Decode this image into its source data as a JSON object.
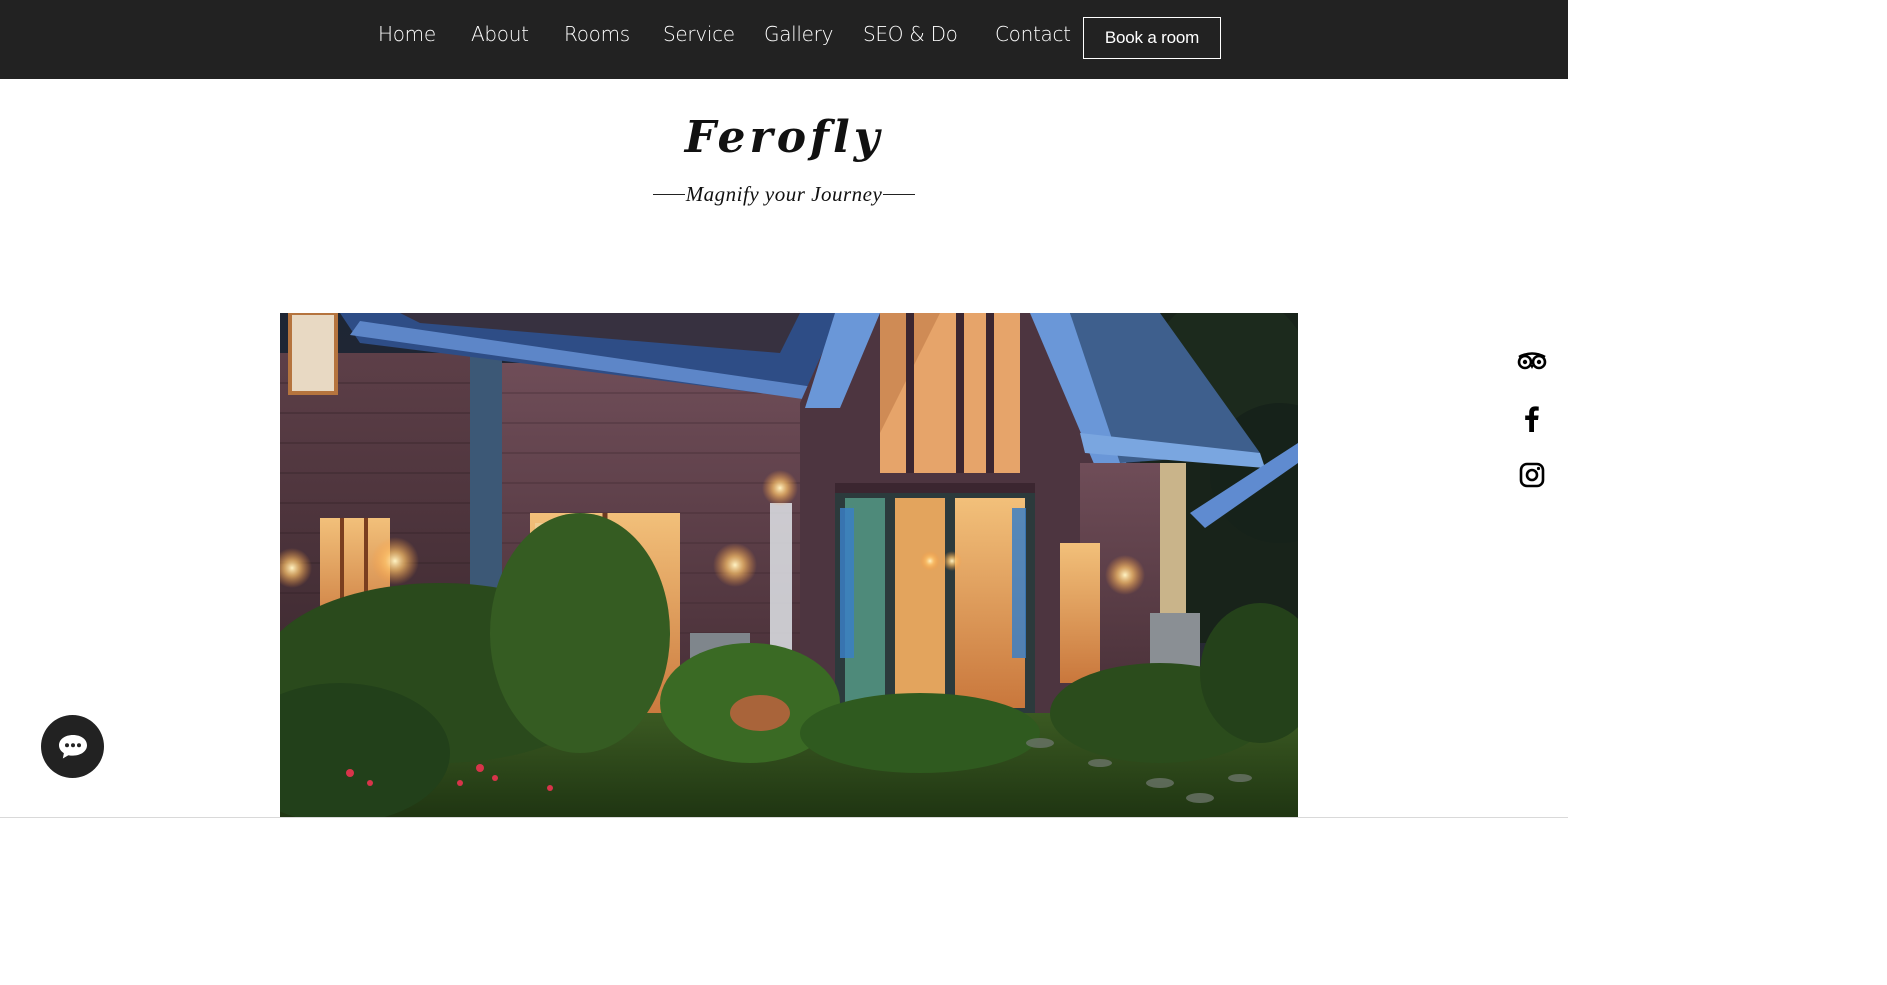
{
  "nav": {
    "items": [
      {
        "label": "Home"
      },
      {
        "label": "About"
      },
      {
        "label": "Rooms"
      },
      {
        "label": "Service"
      },
      {
        "label": "Gallery"
      },
      {
        "label": "SEO & Do"
      },
      {
        "label": "Contact"
      }
    ],
    "book_label": "Book a room"
  },
  "brand": {
    "title": "Ferofly",
    "tagline": "Magnify your Journey"
  },
  "social": {
    "items": [
      {
        "icon": "tripadvisor-icon"
      },
      {
        "icon": "facebook-icon"
      },
      {
        "icon": "instagram-icon"
      }
    ]
  },
  "chat": {
    "icon": "chat-icon"
  },
  "colors": {
    "nav_bg": "#222222",
    "text_light": "#ffffff",
    "text_dark": "#111111"
  }
}
